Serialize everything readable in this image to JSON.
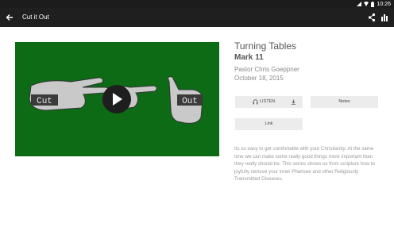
{
  "statusbar": {
    "time": "10:26"
  },
  "appbar": {
    "title": "Cut it Out"
  },
  "video": {
    "thumb_left_text": "Cut",
    "thumb_right_text": "Out"
  },
  "sermon": {
    "series": "Turning Tables",
    "passage": "Mark 11",
    "speaker": "Pastor Chris Goeppner",
    "date": "October 18, 2015"
  },
  "buttons": {
    "listen": "LISTEN",
    "notes": "Notes",
    "link": "Link"
  },
  "description": "Its so easy to get comfortable with your Christianity. At the same time we can make some really good things more important than they really should be. This series shows us from scripture how to joyfully remove your inner Pharisee and other Religiously Transmitted Diseases."
}
